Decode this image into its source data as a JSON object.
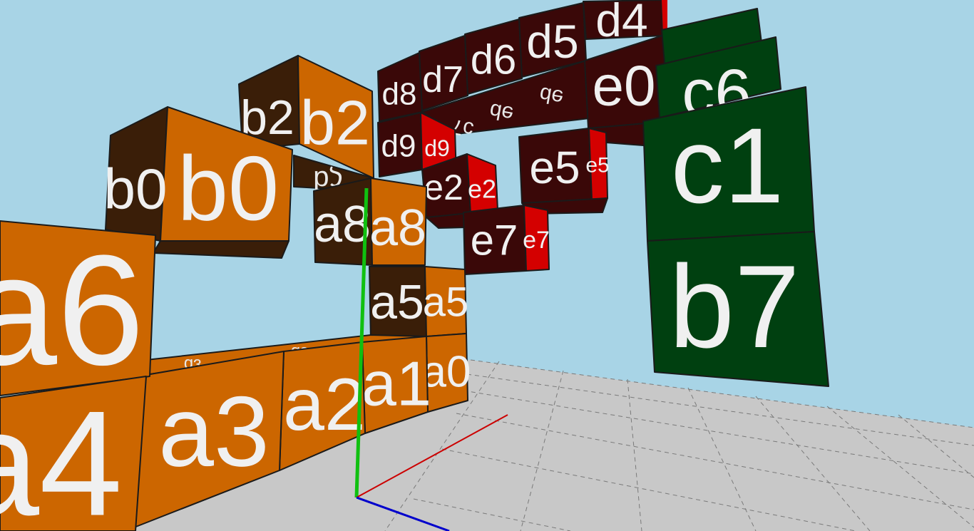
{
  "scene": {
    "colors": {
      "sky": "#a8d4e6",
      "floor": "#c8c8c8",
      "grid_line": "#6e6e6e",
      "orange_face": "#cc6600",
      "orange_dark": "#3a1e08",
      "maroon_face": "#3a0808",
      "red_face": "#d40000",
      "green_face": "#004010",
      "axis_x": "#cc0000",
      "axis_y": "#10c010",
      "axis_z": "#0000cc"
    },
    "axes": [
      {
        "name": "x",
        "color": "#cc0000"
      },
      {
        "name": "y",
        "color": "#10c010"
      },
      {
        "name": "z",
        "color": "#0000cc"
      }
    ],
    "blocks": [
      {
        "id": "a4",
        "group": "a",
        "faces": [
          "a4"
        ]
      },
      {
        "id": "a6",
        "group": "a",
        "faces": [
          "a6"
        ]
      },
      {
        "id": "a3",
        "group": "a",
        "faces": [
          "a3"
        ]
      },
      {
        "id": "a2",
        "group": "a",
        "faces": [
          "a2"
        ]
      },
      {
        "id": "a1",
        "group": "a",
        "faces": [
          "a1"
        ]
      },
      {
        "id": "a0",
        "group": "a",
        "faces": [
          "a0"
        ]
      },
      {
        "id": "a5",
        "group": "a",
        "faces": [
          "a5",
          "a5"
        ]
      },
      {
        "id": "a8",
        "group": "a",
        "faces": [
          "a8",
          "a8"
        ]
      },
      {
        "id": "b0",
        "group": "b",
        "faces": [
          "b0",
          "b0"
        ]
      },
      {
        "id": "b2",
        "group": "b",
        "faces": [
          "b2",
          "b2"
        ]
      },
      {
        "id": "d8",
        "group": "d",
        "faces": [
          "d8"
        ]
      },
      {
        "id": "d7",
        "group": "d",
        "faces": [
          "d7"
        ]
      },
      {
        "id": "d6",
        "group": "d",
        "faces": [
          "d6"
        ]
      },
      {
        "id": "d5",
        "group": "d",
        "faces": [
          "d5"
        ]
      },
      {
        "id": "d4",
        "group": "d",
        "faces": [
          "d4"
        ]
      },
      {
        "id": "d9",
        "group": "d",
        "faces": [
          "d9",
          "d9"
        ]
      },
      {
        "id": "e0",
        "group": "e",
        "faces": [
          "e0"
        ]
      },
      {
        "id": "e2",
        "group": "e",
        "faces": [
          "e2",
          "e2"
        ]
      },
      {
        "id": "e5",
        "group": "e",
        "faces": [
          "e5",
          "e5"
        ]
      },
      {
        "id": "e7",
        "group": "e",
        "faces": [
          "e7",
          "e7"
        ]
      },
      {
        "id": "c1",
        "group": "c",
        "faces": [
          "c1"
        ]
      },
      {
        "id": "c6",
        "group": "c",
        "faces": [
          "c6"
        ]
      },
      {
        "id": "b7",
        "group": "c",
        "faces": [
          "b7"
        ]
      }
    ]
  }
}
